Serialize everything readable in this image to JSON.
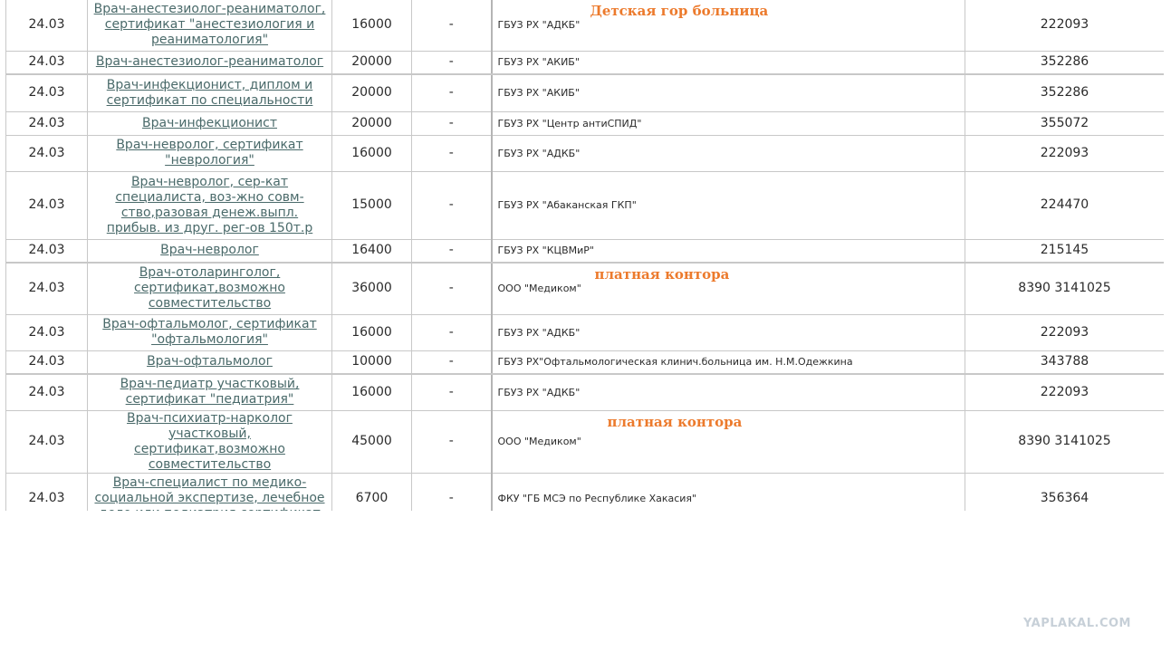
{
  "rows": [
    {
      "date": "24.03",
      "job": "Врач-анестезиолог-реаниматолог, сертификат \"анестезиология и реаниматология\"",
      "salary": "16000",
      "dash": "-",
      "org": "ГБУЗ РХ \"АДКБ\"",
      "note": "Детская гор больница",
      "phone": "222093"
    },
    {
      "date": "24.03",
      "job": "Врач-анестезиолог-реаниматолог",
      "salary": "20000",
      "dash": "-",
      "org": "ГБУЗ РХ \"АКИБ\"",
      "note": "",
      "phone": "352286"
    },
    {
      "date": "24.03",
      "job": "Врач-инфекционист, диплом и сертификат по специальности",
      "salary": "20000",
      "dash": "-",
      "org": "ГБУЗ РХ \"АКИБ\"",
      "note": "",
      "phone": "352286"
    },
    {
      "date": "24.03",
      "job": "Врач-инфекционист",
      "salary": "20000",
      "dash": "-",
      "org": "ГБУЗ РХ \"Центр антиСПИД\"",
      "note": "",
      "phone": "355072"
    },
    {
      "date": "24.03",
      "job": "Врач-невролог, сертификат \"неврология\"",
      "salary": "16000",
      "dash": "-",
      "org": "ГБУЗ РХ \"АДКБ\"",
      "note": "",
      "phone": "222093"
    },
    {
      "date": "24.03",
      "job": "Врач-невролог, сер-кат специалиста, воз-жно совм-ство,разовая денеж.выпл. прибыв. из друг. рег-ов 150т.р",
      "salary": "15000",
      "dash": "-",
      "org": "ГБУЗ РХ \"Абаканская ГКП\"",
      "note": "",
      "phone": "224470"
    },
    {
      "date": "24.03",
      "job": "Врач-невролог",
      "salary": "16400",
      "dash": "-",
      "org": "ГБУЗ РХ \"КЦВМиР\"",
      "note": "",
      "phone": "215145"
    },
    {
      "date": "24.03",
      "job": "Врач-отоларинголог, сертификат,возможно совместительство",
      "salary": "36000",
      "dash": "-",
      "org": "ООО \"Медиком\"",
      "note": "платная контора",
      "phone": "8390 3141025"
    },
    {
      "date": "24.03",
      "job": "Врач-офтальмолог, сертификат \"офтальмология\"",
      "salary": "16000",
      "dash": "-",
      "org": "ГБУЗ РХ \"АДКБ\"",
      "note": "",
      "phone": "222093"
    },
    {
      "date": "24.03",
      "job": "Врач-офтальмолог",
      "salary": "10000",
      "dash": "-",
      "org": "ГБУЗ РХ\"Офтальмологическая клинич.больница им. Н.М.Одежкина",
      "note": "",
      "phone": "343788"
    },
    {
      "date": "24.03",
      "job": "Врач-педиатр участковый, сертификат \"педиатрия\"",
      "salary": "16000",
      "dash": "-",
      "org": "ГБУЗ РХ \"АДКБ\"",
      "note": "",
      "phone": "222093"
    },
    {
      "date": "24.03",
      "job": "Врач-психиатр-нарколог участковый, сертификат,возможно совместительство",
      "salary": "45000",
      "dash": "-",
      "org": "ООО \"Медиком\"",
      "note": "платная контора",
      "phone": "8390 3141025"
    },
    {
      "date": "24.03",
      "job": "Врач-специалист по медико-социальной экспертизе, лечебное дело или педиатрия,сертификат",
      "salary": "6700",
      "dash": "-",
      "org": "ФКУ \"ГБ МСЭ по Республике Хакасия\"",
      "note": "",
      "phone": "356364"
    }
  ],
  "watermark": "YAPLAKAL.COM"
}
